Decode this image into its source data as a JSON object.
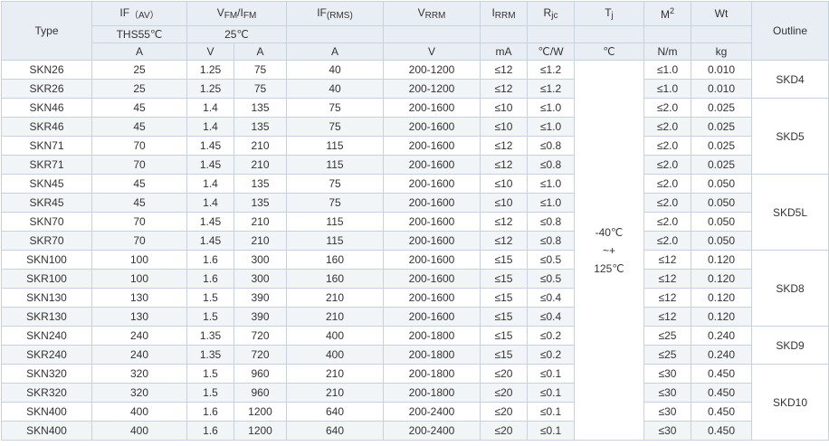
{
  "header": {
    "type": "Type",
    "if_av": {
      "main": "IF",
      "unit": "（AV）"
    },
    "vfm": {
      "main": "V",
      "sub": "FM",
      "sep": "/I",
      "sub2": "FM"
    },
    "if_rms": {
      "main": "IF",
      "sub": "(RMS)"
    },
    "vrrm": {
      "main": "V",
      "sub": "RRM"
    },
    "irrm": {
      "main": "I",
      "sub": "RRM"
    },
    "rjc": {
      "main": "R",
      "sub": "jc"
    },
    "tj": {
      "main": "T",
      "sub": "j"
    },
    "m": {
      "main": "M",
      "sup": "2"
    },
    "wt": "Wt",
    "outline": "Outline",
    "cond_ths": "THS55℃",
    "cond_25": "25℃",
    "units": [
      "A",
      "V",
      "A",
      "A",
      "V",
      "mA",
      "℃/W",
      "℃",
      "N/m",
      "kg"
    ]
  },
  "rows": [
    {
      "type": "SKN26",
      "if_av": "25",
      "vfm": "1.25",
      "ifm": "75",
      "if_rms": "40",
      "vrrm": "200-1200",
      "irrm": "≤12",
      "rjc": "≤1.2",
      "m": "≤1.0",
      "wt": "0.010"
    },
    {
      "type": "SKR26",
      "if_av": "25",
      "vfm": "1.25",
      "ifm": "75",
      "if_rms": "40",
      "vrrm": "200-1200",
      "irrm": "≤12",
      "rjc": "≤1.2",
      "m": "≤1.0",
      "wt": "0.010"
    },
    {
      "type": "SKN46",
      "if_av": "45",
      "vfm": "1.4",
      "ifm": "135",
      "if_rms": "75",
      "vrrm": "200-1600",
      "irrm": "≤10",
      "rjc": "≤1.0",
      "m": "≤2.0",
      "wt": "0.025"
    },
    {
      "type": "SKR46",
      "if_av": "45",
      "vfm": "1.4",
      "ifm": "135",
      "if_rms": "75",
      "vrrm": "200-1600",
      "irrm": "≤10",
      "rjc": "≤1.0",
      "m": "≤2.0",
      "wt": "0.025"
    },
    {
      "type": "SKN71",
      "if_av": "70",
      "vfm": "1.45",
      "ifm": "210",
      "if_rms": "115",
      "vrrm": "200-1600",
      "irrm": "≤12",
      "rjc": "≤0.8",
      "m": "≤2.0",
      "wt": "0.025"
    },
    {
      "type": "SKR71",
      "if_av": "70",
      "vfm": "1.45",
      "ifm": "210",
      "if_rms": "115",
      "vrrm": "200-1600",
      "irrm": "≤12",
      "rjc": "≤0.8",
      "m": "≤2.0",
      "wt": "0.025"
    },
    {
      "type": "SKN45",
      "if_av": "45",
      "vfm": "1.4",
      "ifm": "135",
      "if_rms": "75",
      "vrrm": "200-1600",
      "irrm": "≤10",
      "rjc": "≤1.0",
      "m": "≤2.0",
      "wt": "0.050"
    },
    {
      "type": "SKR45",
      "if_av": "45",
      "vfm": "1.4",
      "ifm": "135",
      "if_rms": "75",
      "vrrm": "200-1600",
      "irrm": "≤10",
      "rjc": "≤1.0",
      "m": "≤2.0",
      "wt": "0.050"
    },
    {
      "type": "SKN70",
      "if_av": "70",
      "vfm": "1.45",
      "ifm": "210",
      "if_rms": "115",
      "vrrm": "200-1600",
      "irrm": "≤12",
      "rjc": "≤0.8",
      "m": "≤2.0",
      "wt": "0.050"
    },
    {
      "type": "SKR70",
      "if_av": "70",
      "vfm": "1.45",
      "ifm": "210",
      "if_rms": "115",
      "vrrm": "200-1600",
      "irrm": "≤12",
      "rjc": "≤0.8",
      "m": "≤2.0",
      "wt": "0.050"
    },
    {
      "type": "SKN100",
      "if_av": "100",
      "vfm": "1.6",
      "ifm": "300",
      "if_rms": "160",
      "vrrm": "200-1600",
      "irrm": "≤15",
      "rjc": "≤0.5",
      "m": "≤12",
      "wt": "0.120"
    },
    {
      "type": "SKR100",
      "if_av": "100",
      "vfm": "1.6",
      "ifm": "300",
      "if_rms": "160",
      "vrrm": "200-1600",
      "irrm": "≤15",
      "rjc": "≤0.5",
      "m": "≤12",
      "wt": "0.120"
    },
    {
      "type": "SKN130",
      "if_av": "130",
      "vfm": "1.5",
      "ifm": "390",
      "if_rms": "210",
      "vrrm": "200-1600",
      "irrm": "≤15",
      "rjc": "≤0.4",
      "m": "≤12",
      "wt": "0.120"
    },
    {
      "type": "SKR130",
      "if_av": "130",
      "vfm": "1.5",
      "ifm": "390",
      "if_rms": "210",
      "vrrm": "200-1600",
      "irrm": "≤15",
      "rjc": "≤0.4",
      "m": "≤12",
      "wt": "0.120"
    },
    {
      "type": "SKN240",
      "if_av": "240",
      "vfm": "1.35",
      "ifm": "720",
      "if_rms": "400",
      "vrrm": "200-1800",
      "irrm": "≤15",
      "rjc": "≤0.2",
      "m": "≤25",
      "wt": "0.240"
    },
    {
      "type": "SKR240",
      "if_av": "240",
      "vfm": "1.35",
      "ifm": "720",
      "if_rms": "400",
      "vrrm": "200-1800",
      "irrm": "≤15",
      "rjc": "≤0.2",
      "m": "≤25",
      "wt": "0.240"
    },
    {
      "type": "SKN320",
      "if_av": "320",
      "vfm": "1.5",
      "ifm": "960",
      "if_rms": "210",
      "vrrm": "200-1800",
      "irrm": "≤20",
      "rjc": "≤0.1",
      "m": "≤30",
      "wt": "0.450"
    },
    {
      "type": "SKR320",
      "if_av": "320",
      "vfm": "1.5",
      "ifm": "960",
      "if_rms": "210",
      "vrrm": "200-1800",
      "irrm": "≤20",
      "rjc": "≤0.1",
      "m": "≤30",
      "wt": "0.450"
    },
    {
      "type": "SKN400",
      "if_av": "400",
      "vfm": "1.6",
      "ifm": "1200",
      "if_rms": "640",
      "vrrm": "200-2400",
      "irrm": "≤20",
      "rjc": "≤0.1",
      "m": "≤30",
      "wt": "0.450"
    },
    {
      "type": "SKN400",
      "if_av": "400",
      "vfm": "1.6",
      "ifm": "1200",
      "if_rms": "640",
      "vrrm": "200-2400",
      "irrm": "≤20",
      "rjc": "≤0.1",
      "m": "≤30",
      "wt": "0.450"
    }
  ],
  "tj_range": [
    "-40℃",
    "~+",
    "125℃"
  ],
  "outline_groups": [
    {
      "label": "SKD4",
      "rows": 2
    },
    {
      "label": "SKD5",
      "rows": 4
    },
    {
      "label": "SKD5L",
      "rows": 4
    },
    {
      "label": "SKD8",
      "rows": 4
    },
    {
      "label": "SKD9",
      "rows": 2
    },
    {
      "label": "SKD10",
      "rows": 4
    }
  ]
}
